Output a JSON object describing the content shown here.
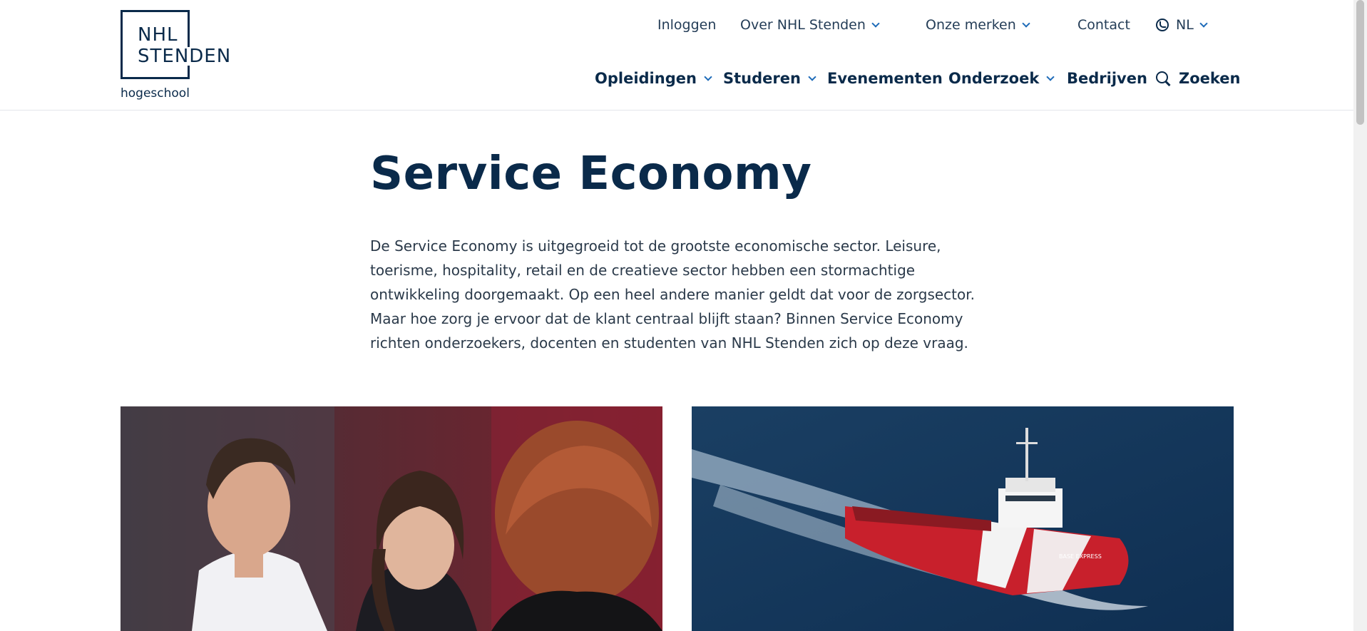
{
  "logo": {
    "line1": "NHL",
    "line2": "STENDEN",
    "sub": "hogeschool"
  },
  "topnav": {
    "login": "Inloggen",
    "about": "Over NHL Stenden",
    "brands": "Onze merken",
    "contact": "Contact",
    "language": "NL"
  },
  "mainnav": {
    "programs": "Opleidingen",
    "studying": "Studeren",
    "events": "Evenementen",
    "research": "Onderzoek",
    "companies": "Bedrijven",
    "search": "Zoeken"
  },
  "page": {
    "title": "Service Economy",
    "intro": "De Service Economy is uitgegroeid tot de grootste economische sector. Leisure, toerisme, hospitality, retail en de creatieve sector hebben een stormachtige ontwikkeling doorgemaakt. Op een heel andere manier geldt dat voor de zorgsector. Maar hoe zorg je ervoor dat de klant centraal blijft staan? Binnen Service Economy richten onderzoekers, docenten en studenten van NHL Stenden zich op deze vraag."
  },
  "images": {
    "ship_name": "BASE EXPRESS"
  },
  "colors": {
    "brand_navy": "#0a2a4a",
    "accent_blue": "#1e6bb8",
    "text": "#2b3a4a"
  }
}
